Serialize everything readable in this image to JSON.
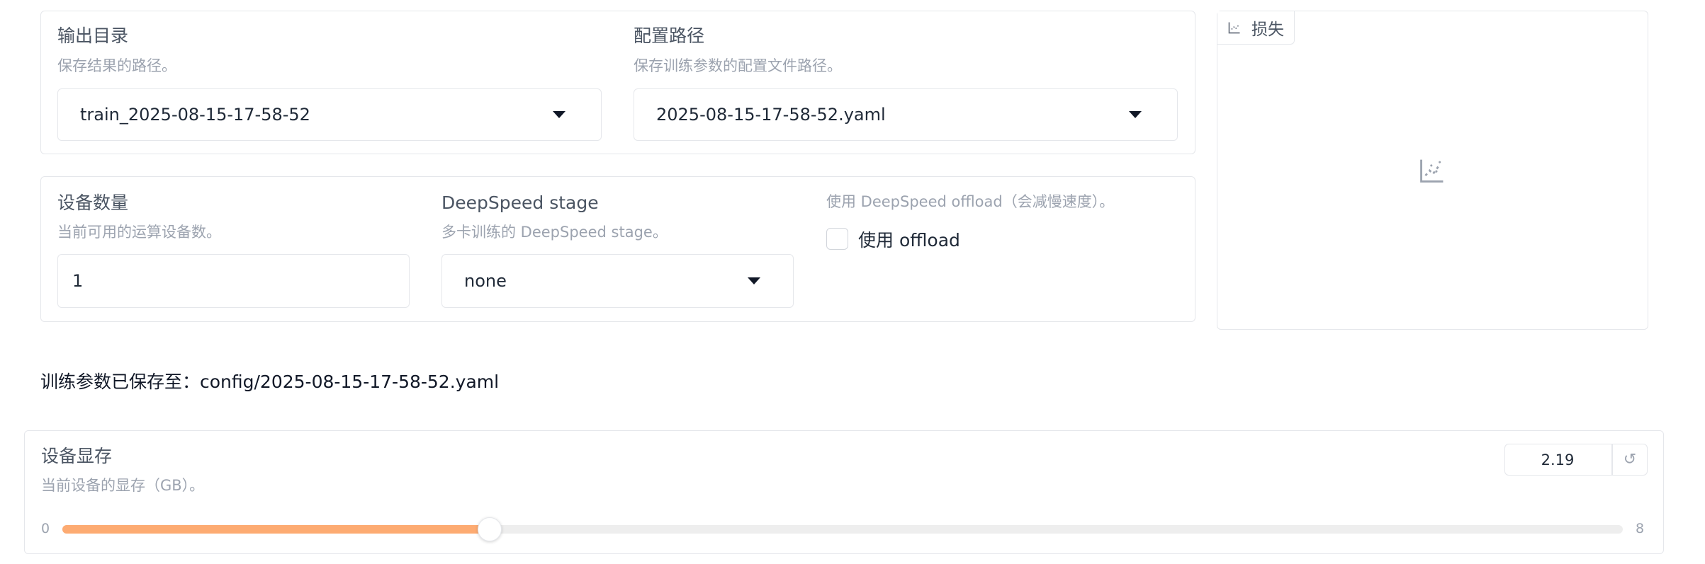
{
  "output_dir": {
    "label": "输出目录",
    "info": "保存结果的路径。",
    "value": "train_2025-08-15-17-58-52"
  },
  "config_path": {
    "label": "配置路径",
    "info": "保存训练参数的配置文件路径。",
    "value": "2025-08-15-17-58-52.yaml"
  },
  "device_count": {
    "label": "设备数量",
    "info": "当前可用的运算设备数。",
    "value": "1"
  },
  "ds_stage": {
    "label": "DeepSpeed stage",
    "info": "多卡训练的 DeepSpeed stage。",
    "value": "none"
  },
  "ds_offload": {
    "info": "使用 DeepSpeed offload（会减慢速度）。",
    "checkbox_label": "使用 offload",
    "checked": false
  },
  "loss_plot": {
    "tab_label": "损失",
    "icon": "chart-icon"
  },
  "status": {
    "saved_message": "训练参数已保存至：config/2025-08-15-17-58-52.yaml"
  },
  "gpu_memory": {
    "label": "设备显存",
    "info": "当前设备的显存（GB）。",
    "value": "2.19",
    "min": "0",
    "max": "8",
    "fraction": 0.274,
    "reset_icon": "reset-icon",
    "accent_color": "#fdab72"
  }
}
